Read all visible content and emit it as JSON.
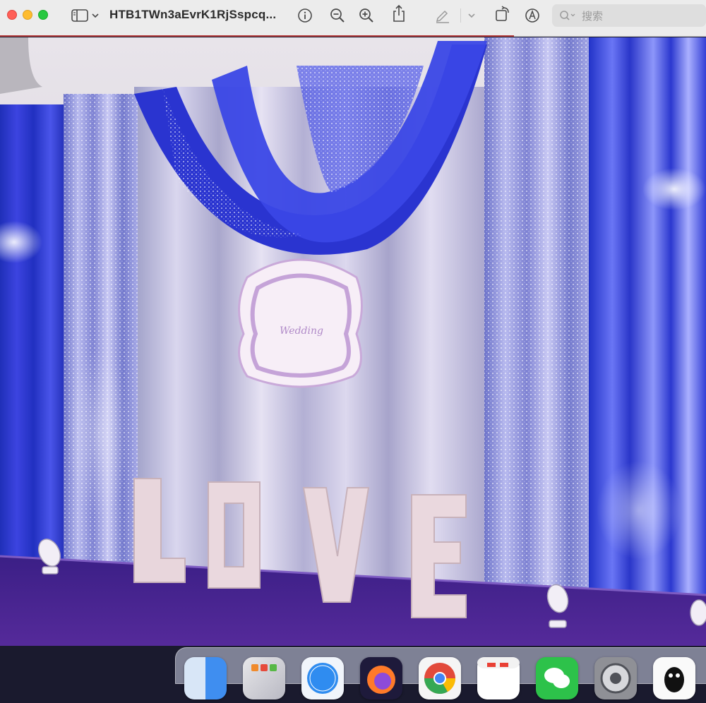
{
  "window": {
    "title": "HTB1TWn3aEvrK1RjSspcq...",
    "search_placeholder": "搜索"
  },
  "toolbar": {
    "icons": [
      "sidebar-toggle-icon",
      "chevron-down-icon",
      "info-icon",
      "zoom-out-icon",
      "zoom-in-icon",
      "share-icon",
      "markup-pen-icon",
      "chevron-down-icon",
      "rotate-icon",
      "annotate-icon",
      "search-icon"
    ]
  },
  "image": {
    "sign_text": "Wedding",
    "letters": [
      "L",
      "O",
      "V",
      "E"
    ]
  },
  "dock": {
    "apps": [
      "finder",
      "launchpad",
      "safari",
      "firefox",
      "chrome",
      "calendar",
      "wechat",
      "system-preferences",
      "qq"
    ]
  }
}
